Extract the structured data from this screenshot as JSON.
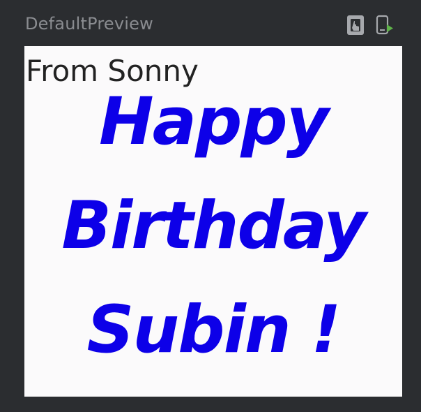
{
  "header": {
    "title": "DefaultPreview",
    "interactive_icon": "interactive-mode-icon",
    "device_icon": "run-on-device-icon"
  },
  "preview": {
    "from": "From Sonny",
    "greeting": "Happy Birthday Subin !"
  },
  "colors": {
    "background": "#2b2d30",
    "canvas": "#fbfafb",
    "greeting": "#0d00e8",
    "title": "#8a8c90",
    "run_accent": "#5fb34a"
  }
}
